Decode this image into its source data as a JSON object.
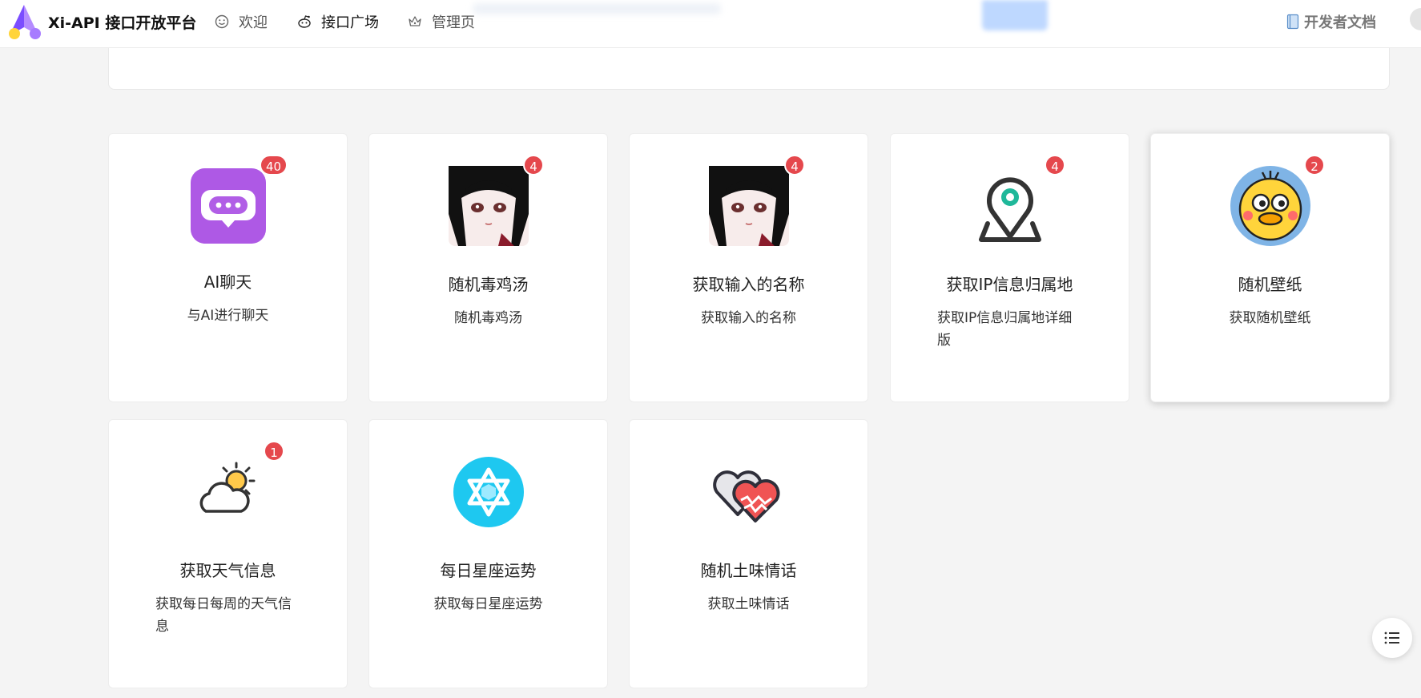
{
  "header": {
    "title": "Xi-API 接口开放平台",
    "nav": [
      {
        "label": "欢迎",
        "icon": "smile-icon"
      },
      {
        "label": "接口广场",
        "icon": "reddit-icon"
      },
      {
        "label": "管理页",
        "icon": "crown-icon"
      }
    ],
    "docs_label": "开发者文档"
  },
  "cards": [
    {
      "title": "AI聊天",
      "description": "与AI进行聊天",
      "badge": "40",
      "icon": "chat-bubble-icon"
    },
    {
      "title": "随机毒鸡汤",
      "description": "随机毒鸡汤",
      "badge": "4",
      "icon": "anime-girl-avatar"
    },
    {
      "title": "获取输入的名称",
      "description": "获取输入的名称",
      "badge": "4",
      "icon": "anime-girl-avatar"
    },
    {
      "title": "获取IP信息归属地",
      "description": "获取IP信息归属地详细版",
      "badge": "4",
      "icon": "location-pin-icon"
    },
    {
      "title": "随机壁纸",
      "description": "获取随机壁纸",
      "badge": "2",
      "icon": "cartoon-chick-avatar"
    },
    {
      "title": "获取天气信息",
      "description": "获取每日每周的天气信息",
      "badge": "1",
      "icon": "weather-cloud-sun-icon"
    },
    {
      "title": "每日星座运势",
      "description": "获取每日星座运势",
      "badge": "",
      "icon": "star-of-david-icon"
    },
    {
      "title": "随机土味情话",
      "description": "获取土味情话",
      "badge": "",
      "icon": "hearts-icon"
    }
  ],
  "colors": {
    "badge": "#e5484d",
    "chat_icon": "#a04fe3",
    "pin_accent": "#1fb89a",
    "star_bg": "#1ec8f0",
    "heart_red": "#f05454"
  }
}
